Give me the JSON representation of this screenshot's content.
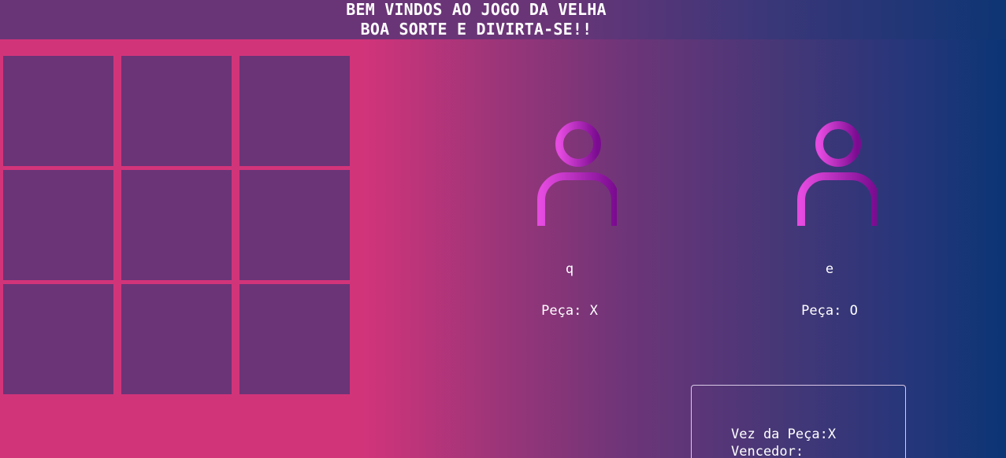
{
  "header": {
    "line1": "BEM VINDOS AO JOGO DA VELHA",
    "line2": "BOA SORTE E DIVIRTA-SE!!"
  },
  "board": {
    "cells": [
      "",
      "",
      "",
      "",
      "",
      "",
      "",
      "",
      ""
    ]
  },
  "players": [
    {
      "name": "q",
      "piece_label": "Peça: X",
      "icon": "user-icon"
    },
    {
      "name": "e",
      "piece_label": "Peça: O",
      "icon": "user-icon"
    }
  ],
  "status": {
    "turn_label": "Vez da Peça:X",
    "winner_label": "Vencedor:"
  },
  "colors": {
    "cell": "#6b3477",
    "accent_pink": "#d2347a",
    "accent_blue": "#0b3575",
    "icon_gradient_start": "#e54be0",
    "icon_gradient_end": "#7b0b91"
  }
}
